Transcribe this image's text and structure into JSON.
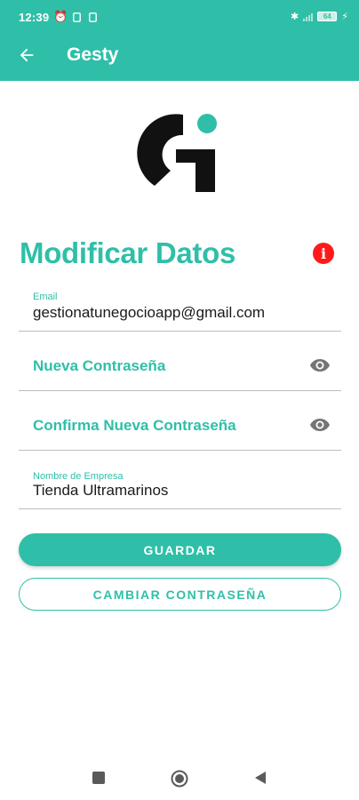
{
  "status_bar": {
    "time": "12:39",
    "battery": "64"
  },
  "app_bar": {
    "title": "Gesty",
    "back_icon": "arrow-left-icon"
  },
  "colors": {
    "accent": "#2fbfa8",
    "alert": "#ff1a1a"
  },
  "logo": {
    "icon": "gesty-logo"
  },
  "form": {
    "heading": "Modificar Datos",
    "info_icon": "info-icon",
    "email": {
      "label": "Email",
      "value": "gestionatunegocioapp@gmail.com"
    },
    "new_password": {
      "placeholder": "Nueva Contraseña",
      "icon": "eye-icon"
    },
    "confirm_password": {
      "placeholder": "Confirma Nueva Contraseña",
      "icon": "eye-icon"
    },
    "company": {
      "label": "Nombre de Empresa",
      "value": "Tienda Ultramarinos"
    }
  },
  "actions": {
    "save_label": "GUARDAR",
    "change_password_label": "CAMBIAR CONTRASEÑA"
  },
  "system_nav": {
    "recents_icon": "square-icon",
    "home_icon": "circle-icon",
    "back_icon": "triangle-back-icon"
  }
}
